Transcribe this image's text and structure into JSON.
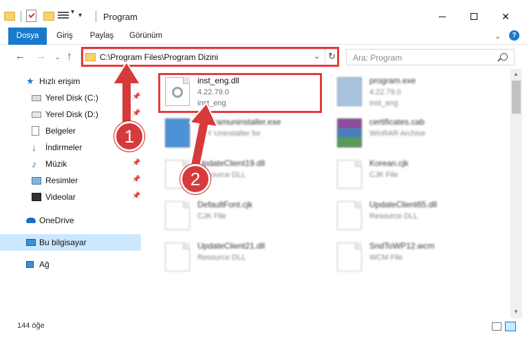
{
  "window": {
    "title": "Program"
  },
  "ribbon": {
    "tabs": [
      "Dosya",
      "Giriş",
      "Paylaş",
      "Görünüm"
    ]
  },
  "address": {
    "path": "C:\\Program Files\\Program Dizini",
    "search_placeholder": "Ara: Program"
  },
  "sidebar": {
    "items": [
      {
        "label": "Hızlı erişim",
        "icon": "star-icon"
      },
      {
        "label": "Yerel Disk (C:)",
        "icon": "drive-icon"
      },
      {
        "label": "Yerel Disk (D:)",
        "icon": "drive-icon"
      },
      {
        "label": "Belgeler",
        "icon": "document-icon"
      },
      {
        "label": "İndirmeler",
        "icon": "download-icon"
      },
      {
        "label": "Müzik",
        "icon": "music-icon"
      },
      {
        "label": "Resimler",
        "icon": "pictures-icon"
      },
      {
        "label": "Videolar",
        "icon": "video-icon"
      },
      {
        "label": "OneDrive",
        "icon": "cloud-icon"
      },
      {
        "label": "Bu bilgisayar",
        "icon": "computer-icon"
      },
      {
        "label": "Ağ",
        "icon": "network-icon"
      }
    ]
  },
  "files": [
    {
      "name": "inst_eng.dll",
      "line2": "4.22.79.0",
      "line3": "inst_eng",
      "icon": "dll-icon"
    },
    {
      "name": "program.exe",
      "line2": "4.22.79.0",
      "line3": "inst_eng",
      "icon": "exe-icon"
    },
    {
      "name": "programuninstaller.exe",
      "line2": "GLY Uninstaller for",
      "line3": "",
      "icon": "exe-icon"
    },
    {
      "name": "certificates.cab",
      "line2": "WinRAR Archive",
      "line3": "",
      "icon": "winrar-icon"
    },
    {
      "name": "UpdateClient19.dll",
      "line2": "Resource DLL",
      "line3": "",
      "icon": "file-icon"
    },
    {
      "name": "Korean.cjk",
      "line2": "CJK File",
      "line3": "",
      "icon": "file-icon"
    },
    {
      "name": "DefaultFont.cjk",
      "line2": "CJK File",
      "line3": "",
      "icon": "file-icon"
    },
    {
      "name": "UpdateClient65.dll",
      "line2": "Resource DLL",
      "line3": "",
      "icon": "file-icon"
    },
    {
      "name": "UpdateClient21.dll",
      "line2": "Resource DLL",
      "line3": "",
      "icon": "file-icon"
    },
    {
      "name": "SndToWP12.wcm",
      "line2": "WCM File",
      "line3": "",
      "icon": "file-icon"
    }
  ],
  "status": {
    "count": "144 öğe"
  },
  "annotations": {
    "badge1": "1",
    "badge2": "2"
  },
  "colors": {
    "accent": "#1979ca",
    "highlight": "#e33b3b"
  }
}
